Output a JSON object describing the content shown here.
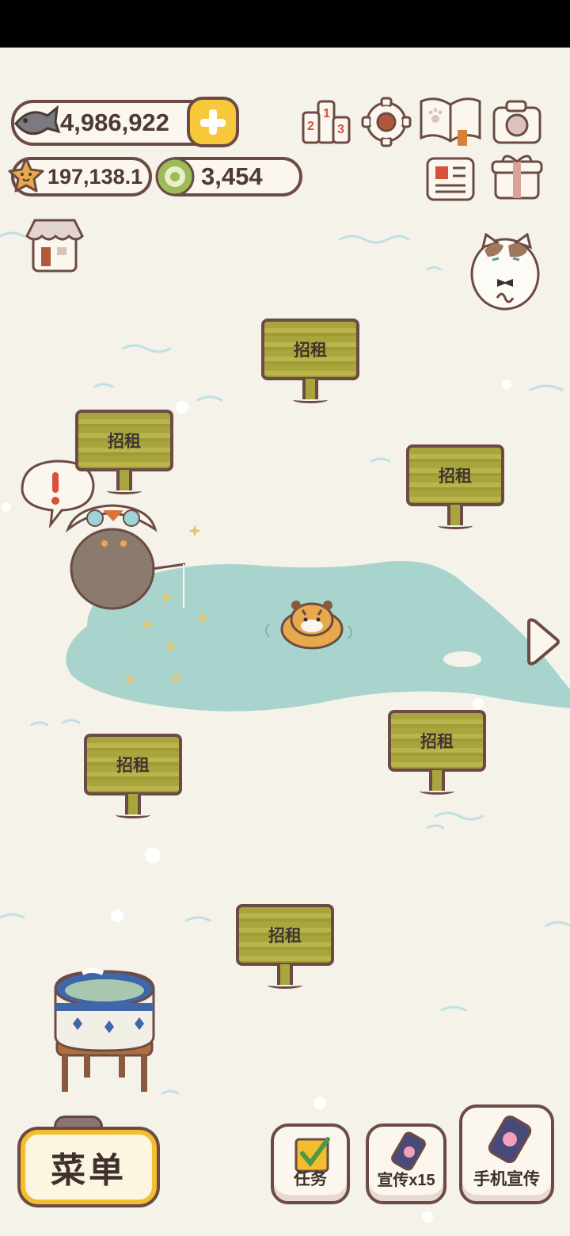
{
  "resources": {
    "fish": "4,986,922",
    "stars": "197,138.1",
    "coins": "3,454"
  },
  "icons": {
    "fish": "fish-icon",
    "star": "star-icon",
    "coin": "coin-icon",
    "plus": "plus-icon",
    "ranking": "ranking-podium-icon",
    "settings": "settings-gear-icon",
    "catalog": "paw-book-icon",
    "camera": "camera-icon",
    "news": "newspaper-icon",
    "gift": "gift-box-icon",
    "shop": "shop-icon",
    "cat_butler": "cat-butler-icon",
    "next": "arrow-right-icon"
  },
  "signs": [
    "招租",
    "招租",
    "招租",
    "招租",
    "招租",
    "招租"
  ],
  "buttons": {
    "menu": "菜单",
    "tasks": "任务",
    "promote_x15": "宣传x15",
    "phone_promote": "手机宣传"
  },
  "colors": {
    "background": "#f4f2e9",
    "lake": "#a9d4ce",
    "sign": "#b1ad42",
    "outline": "#6b4b44",
    "menu_border": "#f2bd2f"
  }
}
